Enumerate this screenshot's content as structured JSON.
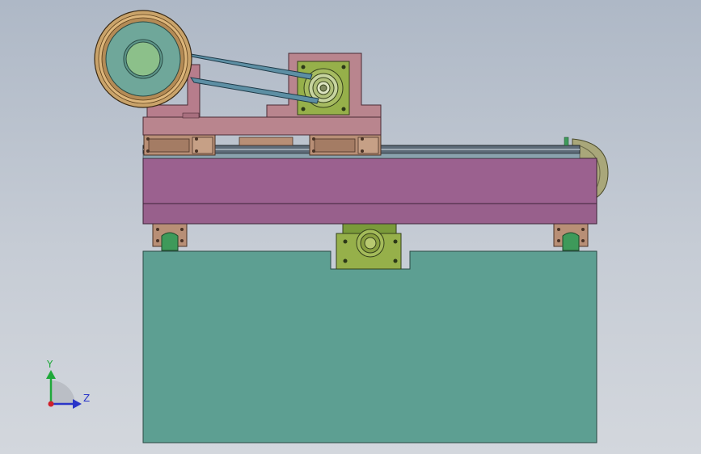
{
  "view": {
    "background_top": "#aeb8c6",
    "background_bottom": "#d3d7dd"
  },
  "triad": {
    "y_label": "Y",
    "z_label": "Z",
    "y_color": "#1fa83a",
    "z_color": "#2a35c8",
    "x_color": "#d0202a"
  },
  "colors": {
    "base_block": "#5d9f92",
    "carriage": "#9b618f",
    "carriage_top": "#a2668f",
    "motor_plate": "#b9858e",
    "pulley_rim": "#c9a36a",
    "pulley_face": "#6fa79a",
    "pulley_hub": "#8cc08a",
    "belt": "#5d8fa4",
    "bearing_block": "#96b04a",
    "rail_block": "#b88f76",
    "rail_green": "#3e9a5a",
    "drum": "#a9a77a"
  }
}
